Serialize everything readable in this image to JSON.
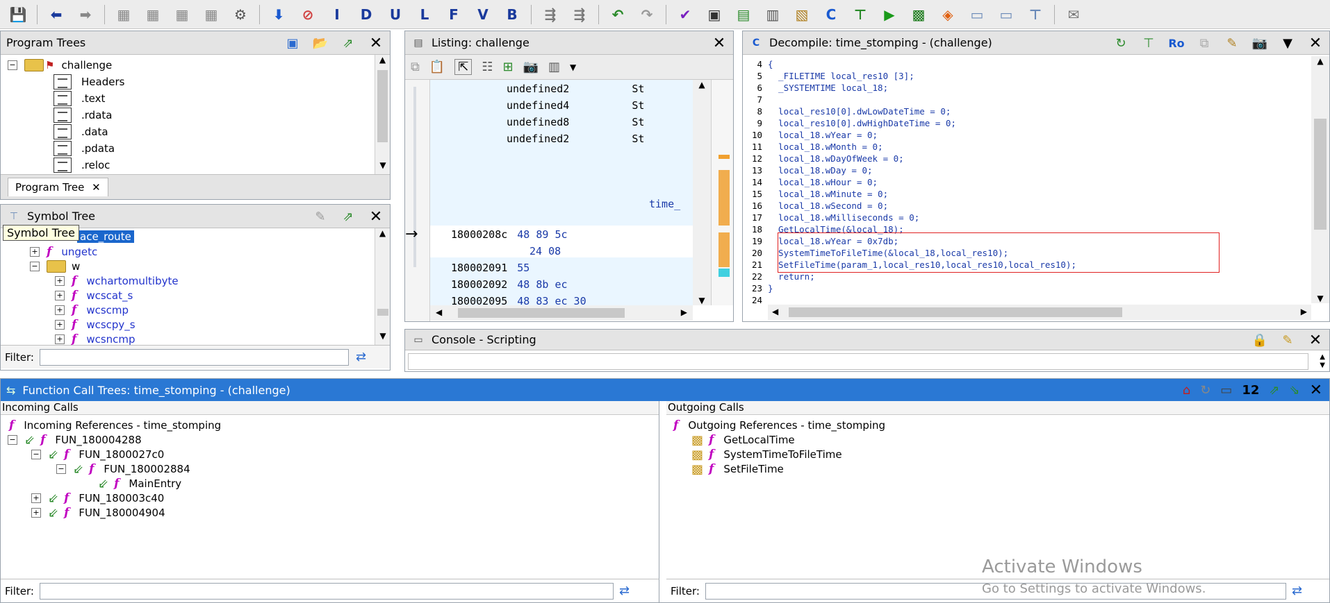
{
  "toolbar": {
    "letter_buttons": [
      "I",
      "D",
      "U",
      "L",
      "F",
      "V",
      "B"
    ]
  },
  "program_trees": {
    "title": "Program Trees",
    "root": "challenge",
    "items": [
      "Headers",
      ".text",
      ".rdata",
      ".data",
      ".pdata",
      ".reloc"
    ],
    "tab_label": "Program Tree"
  },
  "symbol_tree": {
    "title": "Symbol Tree",
    "tooltip": "Symbol Tree",
    "selected_item": "ace_route",
    "items": [
      {
        "label": "ungetc",
        "level": 1,
        "type": "function"
      },
      {
        "label": "w",
        "level": 1,
        "type": "folder"
      },
      {
        "label": "wchartomultibyte",
        "level": 2,
        "type": "function"
      },
      {
        "label": "wcscat_s",
        "level": 2,
        "type": "function"
      },
      {
        "label": "wcscmp",
        "level": 2,
        "type": "function"
      },
      {
        "label": "wcscpy_s",
        "level": 2,
        "type": "function"
      },
      {
        "label": "wcsncmp",
        "level": 2,
        "type": "function"
      }
    ],
    "filter_label": "Filter:"
  },
  "listing": {
    "title": "Listing:  challenge",
    "rows": [
      {
        "addr": "",
        "bytes": "",
        "mnemonic": "undefined2",
        "operand": "St"
      },
      {
        "addr": "",
        "bytes": "",
        "mnemonic": "undefined4",
        "operand": "St"
      },
      {
        "addr": "",
        "bytes": "",
        "mnemonic": "undefined8",
        "operand": "St"
      },
      {
        "addr": "",
        "bytes": "",
        "mnemonic": "undefined2",
        "operand": "St"
      }
    ],
    "label": "time_",
    "asm": [
      {
        "addr": "18000208c",
        "bytes": "48 89 5c"
      },
      {
        "addr": "",
        "bytes": "24 08"
      },
      {
        "addr": "180002091",
        "bytes": "55"
      },
      {
        "addr": "180002092",
        "bytes": "48 8b ec"
      },
      {
        "addr": "180002095",
        "bytes": "48 83 ec 30"
      }
    ]
  },
  "decompile": {
    "title": "Decompile: time_stomping -  (challenge)",
    "lines": [
      {
        "n": "4",
        "t": "{"
      },
      {
        "n": "5",
        "t": "  _FILETIME local_res10 [3];"
      },
      {
        "n": "6",
        "t": "  _SYSTEMTIME local_18;"
      },
      {
        "n": "7",
        "t": ""
      },
      {
        "n": "8",
        "t": "  local_res10[0].dwLowDateTime = 0;"
      },
      {
        "n": "9",
        "t": "  local_res10[0].dwHighDateTime = 0;"
      },
      {
        "n": "10",
        "t": "  local_18.wYear = 0;"
      },
      {
        "n": "11",
        "t": "  local_18.wMonth = 0;"
      },
      {
        "n": "12",
        "t": "  local_18.wDayOfWeek = 0;"
      },
      {
        "n": "13",
        "t": "  local_18.wDay = 0;"
      },
      {
        "n": "14",
        "t": "  local_18.wHour = 0;"
      },
      {
        "n": "15",
        "t": "  local_18.wMinute = 0;"
      },
      {
        "n": "16",
        "t": "  local_18.wSecond = 0;"
      },
      {
        "n": "17",
        "t": "  local_18.wMilliseconds = 0;"
      },
      {
        "n": "18",
        "t": "  GetLocalTime(&local_18);"
      },
      {
        "n": "19",
        "t": "  local_18.wYear = 0x7db;"
      },
      {
        "n": "20",
        "t": "  SystemTimeToFileTime(&local_18,local_res10);"
      },
      {
        "n": "21",
        "t": "  SetFileTime(param_1,local_res10,local_res10,local_res10);"
      },
      {
        "n": "22",
        "t": "  return;"
      },
      {
        "n": "23",
        "t": "}"
      },
      {
        "n": "24",
        "t": ""
      }
    ]
  },
  "console": {
    "title": "Console - Scripting"
  },
  "call_trees": {
    "title": "Function Call Trees: time_stomping -  (challenge)",
    "count": "12",
    "incoming_header": "Incoming Calls",
    "incoming_root": "Incoming References - time_stomping",
    "incoming": [
      {
        "label": "FUN_180004288",
        "level": 1,
        "exp": "−"
      },
      {
        "label": "FUN_1800027c0",
        "level": 2,
        "exp": "−"
      },
      {
        "label": "FUN_180002884",
        "level": 3,
        "exp": "−"
      },
      {
        "label": "MainEntry",
        "level": 4,
        "exp": ""
      },
      {
        "label": "FUN_180003c40",
        "level": 2,
        "exp": "+"
      },
      {
        "label": "FUN_180004904",
        "level": 2,
        "exp": "+"
      }
    ],
    "outgoing_header": "Outgoing Calls",
    "outgoing_root": "Outgoing References - time_stomping",
    "outgoing": [
      "GetLocalTime",
      "SystemTimeToFileTime",
      "SetFileTime"
    ],
    "filter_label": "Filter:"
  },
  "watermark": {
    "line1": "Activate Windows",
    "line2": "Go to Settings to activate Windows."
  }
}
